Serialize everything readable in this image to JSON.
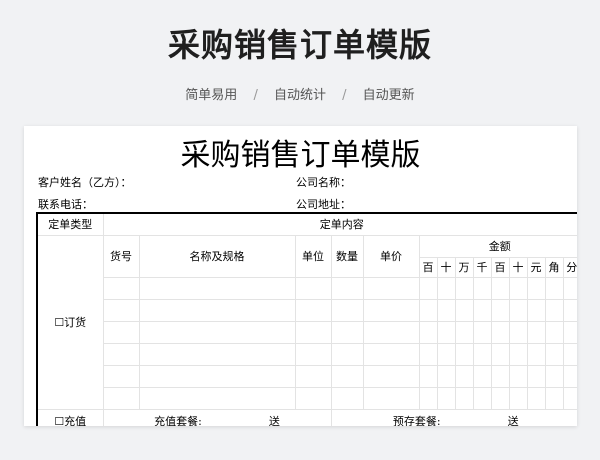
{
  "hero": {
    "title": "采购销售订单模版",
    "tags": [
      "简单易用",
      "自动统计",
      "自动更新"
    ],
    "separator": "/"
  },
  "sheet": {
    "title": "采购销售订单模版",
    "customer_label": "客户姓名（乙方）：",
    "company_name_label": "公司名称：",
    "phone_label": "联系电话：",
    "company_address_label": "公司地址："
  },
  "table": {
    "order_type_header": "定单类型",
    "order_content_header": "定单内容",
    "col_item_no": "货号",
    "col_name_spec": "名称及规格",
    "col_unit": "单位",
    "col_qty": "数量",
    "col_price": "单价",
    "col_amount": "金额",
    "amount_digits": [
      "百",
      "十",
      "万",
      "千",
      "百",
      "十",
      "元",
      "角",
      "分"
    ],
    "type_order": "☐订货",
    "type_recharge": "☐充值",
    "recharge_package_label": "充值套餐:",
    "recharge_gift_label": "送",
    "prestore_package_label": "预存套餐:",
    "prestore_gift_label": "送"
  }
}
